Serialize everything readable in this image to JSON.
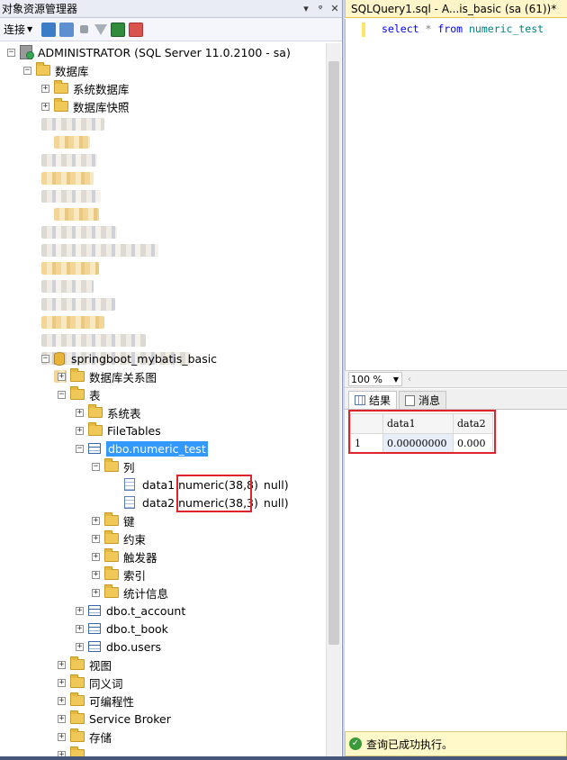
{
  "object_explorer": {
    "title": "对象资源管理器",
    "connect_label": "连接",
    "title_buttons": [
      "▾",
      "ᵠ",
      "✕"
    ],
    "server": "ADMINISTRATOR (SQL Server 11.0.2100 - sa)",
    "databases_label": "数据库",
    "system_databases": "系统数据库",
    "db_snapshots": "数据库快照",
    "database": "springboot_mybatis_basic",
    "db_diagrams": "数据库关系图",
    "tables_label": "表",
    "system_tables": "系统表",
    "file_tables": "FileTables",
    "selected_table": "dbo.numeric_test",
    "columns_label": "列",
    "columns": [
      {
        "name": "data1",
        "type": "numeric(38,8)",
        "null": "null)"
      },
      {
        "name": "data2",
        "type": "numeric(38,3)",
        "null": "null)"
      }
    ],
    "table_children": [
      "键",
      "约束",
      "触发器",
      "索引",
      "统计信息"
    ],
    "other_tables": [
      "dbo.t_account",
      "dbo.t_book",
      "dbo.users"
    ],
    "db_children": [
      "视图",
      "同义词",
      "可编程性",
      "Service Broker",
      "存储"
    ]
  },
  "query_window": {
    "tab_title": "SQLQuery1.sql - A...is_basic (sa (61))*",
    "sql": {
      "kw1": "select",
      "op": "*",
      "kw2": "from",
      "table": "numeric_test"
    },
    "zoom": "100 %",
    "result_tabs": [
      "结果",
      "消息"
    ],
    "grid_headers": [
      "data1",
      "data2"
    ],
    "grid_rows": [
      {
        "num": "1",
        "data1": "0.00000000",
        "data2": "0.000"
      }
    ],
    "status": "查询已成功执行。"
  }
}
